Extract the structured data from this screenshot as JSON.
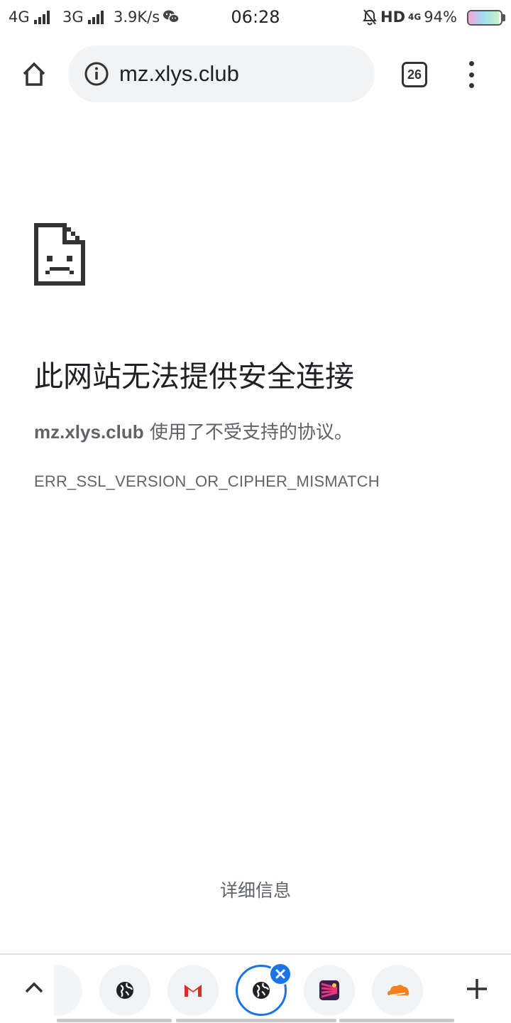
{
  "status_bar": {
    "network1": "4G",
    "network2": "3G",
    "speed": "3.9K/s",
    "time": "06:28",
    "hd_label": "HD",
    "volte_label": "4G",
    "battery": "94%",
    "battery_level": 0.94
  },
  "toolbar": {
    "url": "mz.xlys.club",
    "tab_count": "26"
  },
  "error": {
    "title": "此网站无法提供安全连接",
    "host": "mz.xlys.club",
    "description": " 使用了不受支持的协议。",
    "code": "ERR_SSL_VERSION_OR_CIPHER_MISMATCH",
    "details_link": "详细信息"
  },
  "tab_strip": {
    "tabs": [
      {
        "icon": "faded-tab-icon"
      },
      {
        "icon": "globe-icon"
      },
      {
        "icon": "gmail-icon"
      },
      {
        "icon": "globe-icon",
        "active": true
      },
      {
        "icon": "app-logo-icon"
      },
      {
        "icon": "cloudflare-icon"
      }
    ],
    "colors": {
      "accent": "#1a73e8",
      "gmail_red": "#d93025",
      "cloudflare_orange": "#f48120"
    }
  }
}
